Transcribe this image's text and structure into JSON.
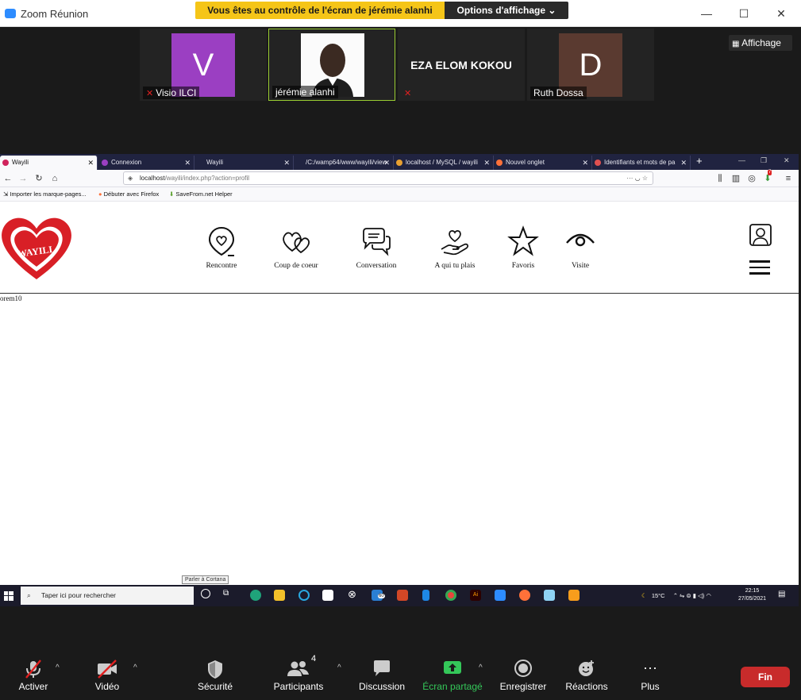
{
  "zoom": {
    "window_title": "Zoom Réunion",
    "control_banner": "Vous êtes au contrôle de l'écran de jérémie alanhi",
    "view_options": "Options d'affichage ⌄",
    "view_button": "Affichage",
    "participants": [
      {
        "name": "Visio ILCI",
        "avatar": "V",
        "avatar_color": "#9b3fc2",
        "muted": true
      },
      {
        "name": "jérémie alanhi",
        "avatar": "photo",
        "muted": false,
        "active_speaker": true
      },
      {
        "name": "EZA ELOM KOKOU",
        "avatar": "",
        "muted": true
      },
      {
        "name": "Ruth Dossa",
        "avatar": "D",
        "avatar_color": "#5a3a30",
        "muted": false
      }
    ],
    "toolbar": {
      "mute": "Activer",
      "video": "Vidéo",
      "security": "Sécurité",
      "participants": "Participants",
      "participants_count": "4",
      "chat": "Discussion",
      "share": "Écran partagé",
      "record": "Enregistrer",
      "reactions": "Réactions",
      "more": "Plus",
      "end": "Fin"
    }
  },
  "browser": {
    "tabs": [
      {
        "label": "Wayili",
        "active": true,
        "icon_color": "#d0245c"
      },
      {
        "label": "Connexion",
        "active": false,
        "icon_color": "#9b3fc2"
      },
      {
        "label": "Wayili",
        "active": false,
        "icon_color": ""
      },
      {
        "label": "/C:/wamp64/www/wayili/view",
        "active": false,
        "icon_color": ""
      },
      {
        "label": "localhost / MySQL / wayili",
        "active": false,
        "icon_color": "#e8a030"
      },
      {
        "label": "Nouvel onglet",
        "active": false,
        "icon_color": "#ff7139"
      },
      {
        "label": "Identifiants et mots de pa",
        "active": false,
        "icon_color": "#e05050"
      }
    ],
    "url_host": "localhost",
    "url_path": "/wayili/index.php?action=profil",
    "bookmarks": [
      "Importer les marque-pages...",
      "Débuter avec Firefox",
      "SaveFrom.net Helper"
    ],
    "notification_badge": "7"
  },
  "site": {
    "logo_text": "WAYILI",
    "nav": [
      {
        "label": "Rencontre",
        "icon": "location-heart-icon"
      },
      {
        "label": "Coup de coeur",
        "icon": "two-hearts-icon"
      },
      {
        "label": "Conversation",
        "icon": "chat-bubbles-icon"
      },
      {
        "label": "A qui tu plais",
        "icon": "hand-heart-icon"
      },
      {
        "label": "Favoris",
        "icon": "star-icon"
      },
      {
        "label": "Visite",
        "icon": "eye-icon"
      }
    ],
    "body_text": "orem10"
  },
  "windows": {
    "search_placeholder": "Taper ici pour rechercher",
    "cortana_tooltip": "Parler à Cortana",
    "weather": "15°C",
    "time": "22:15",
    "date": "27/05/2021",
    "mail_badge": "60"
  }
}
